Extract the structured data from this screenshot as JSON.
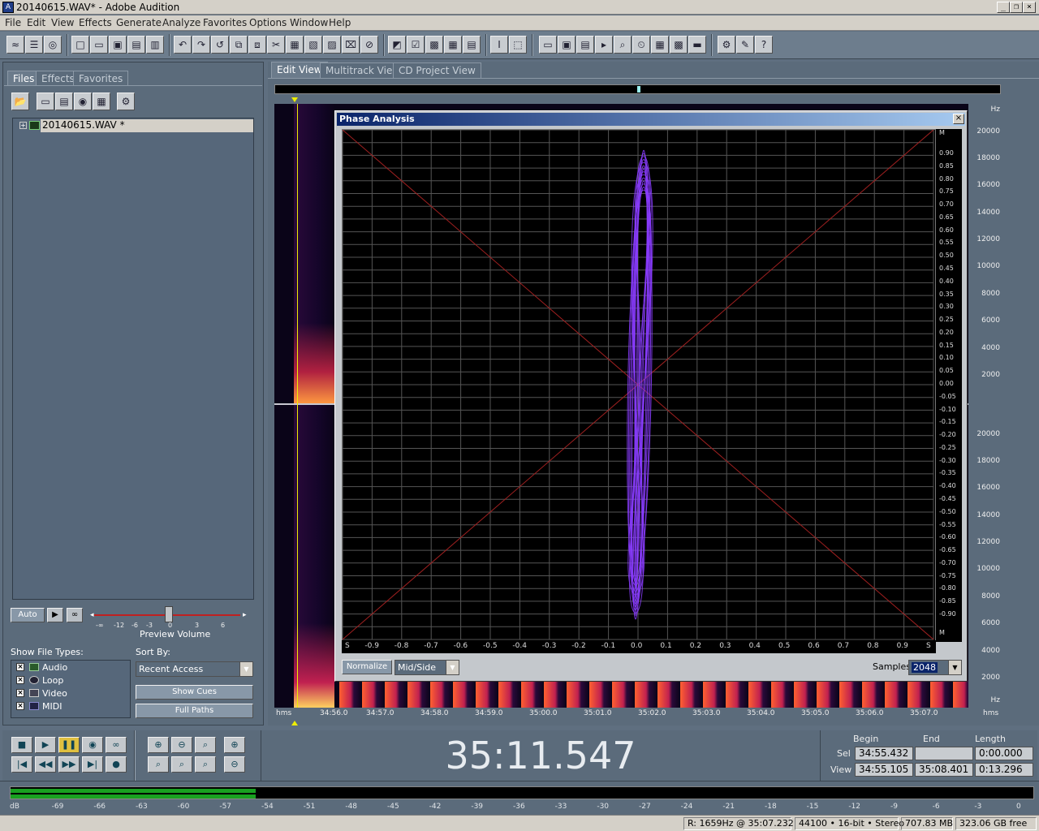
{
  "window": {
    "title": "20140615.WAV* - Adobe Audition",
    "app_icon": "audition-icon"
  },
  "menu": [
    "File",
    "Edit",
    "View",
    "Effects",
    "Generate",
    "Analyze",
    "Favorites",
    "Options",
    "Window",
    "Help"
  ],
  "left_panel": {
    "tabs": [
      "Files",
      "Effects",
      "Favorites"
    ],
    "file_item": "20140615.WAV *",
    "auto_label": "Auto",
    "volume_ticks": [
      "-∞",
      "-12",
      "-6",
      "-3",
      "0",
      "3",
      "6"
    ],
    "preview_volume_label": "Preview Volume",
    "show_file_types_label": "Show File Types:",
    "file_types": [
      "Audio",
      "Loop",
      "Video",
      "MIDI"
    ],
    "sort_by_label": "Sort By:",
    "sort_by_value": "Recent Access",
    "show_cues_label": "Show Cues",
    "full_paths_label": "Full Paths"
  },
  "view_tabs": [
    "Edit View",
    "Multitrack View",
    "CD Project View"
  ],
  "freq_scale": {
    "unit": "Hz",
    "top": [
      "20000",
      "18000",
      "16000",
      "14000",
      "12000",
      "10000",
      "8000",
      "6000",
      "4000",
      "2000"
    ],
    "bottom": [
      "20000",
      "18000",
      "16000",
      "14000",
      "12000",
      "10000",
      "8000",
      "6000",
      "4000",
      "2000"
    ]
  },
  "timeline": {
    "unit": "hms",
    "ticks": [
      "34:56.0",
      "34:57.0",
      "34:58.0",
      "34:59.0",
      "35:00.0",
      "35:01.0",
      "35:02.0",
      "35:03.0",
      "35:04.0",
      "35:05.0",
      "35:06.0",
      "35:07.0"
    ]
  },
  "phase_dialog": {
    "title": "Phase Analysis",
    "close_label": "×",
    "m_label": "M",
    "s_label": "S",
    "m_ticks": [
      "0.90",
      "0.85",
      "0.80",
      "0.75",
      "0.70",
      "0.65",
      "0.60",
      "0.55",
      "0.50",
      "0.45",
      "0.40",
      "0.35",
      "0.30",
      "0.25",
      "0.20",
      "0.15",
      "0.10",
      "0.05",
      "0.00",
      "-0.05",
      "-0.10",
      "-0.15",
      "-0.20",
      "-0.25",
      "-0.30",
      "-0.35",
      "-0.40",
      "-0.45",
      "-0.50",
      "-0.55",
      "-0.60",
      "-0.65",
      "-0.70",
      "-0.75",
      "-0.80",
      "-0.85",
      "-0.90"
    ],
    "s_ticks": [
      "-0.9",
      "-0.8",
      "-0.7",
      "-0.6",
      "-0.5",
      "-0.4",
      "-0.3",
      "-0.2",
      "-0.1",
      "0.0",
      "0.1",
      "0.2",
      "0.3",
      "0.4",
      "0.5",
      "0.6",
      "0.7",
      "0.8",
      "0.9"
    ],
    "normalize_label": "Normalize",
    "mode_value": "Mid/Side",
    "samples_label": "Samples",
    "samples_value": "2048",
    "trace_color": "#8a3cff"
  },
  "transport": {
    "current_time": "35:11.547",
    "headers": [
      "Begin",
      "End",
      "Length"
    ],
    "sel_label": "Sel",
    "view_label": "View",
    "sel": {
      "begin": "34:55.432",
      "end": "",
      "length": "0:00.000"
    },
    "view": {
      "begin": "34:55.105",
      "end": "35:08.401",
      "length": "0:13.296"
    }
  },
  "level_meter": {
    "ticks": [
      "dB",
      "-69",
      "-66",
      "-63",
      "-60",
      "-57",
      "-54",
      "-51",
      "-48",
      "-45",
      "-42",
      "-39",
      "-36",
      "-33",
      "-30",
      "-27",
      "-24",
      "-21",
      "-18",
      "-15",
      "-12",
      "-9",
      "-6",
      "-3",
      "0"
    ],
    "level_fraction": 0.24,
    "color": "#19a020"
  },
  "status_bar": {
    "cursor": "R: 1659Hz @  35:07.232",
    "format": "44100 • 16-bit • Stereo",
    "size": "707.83 MB",
    "free": "323.06 GB free"
  }
}
